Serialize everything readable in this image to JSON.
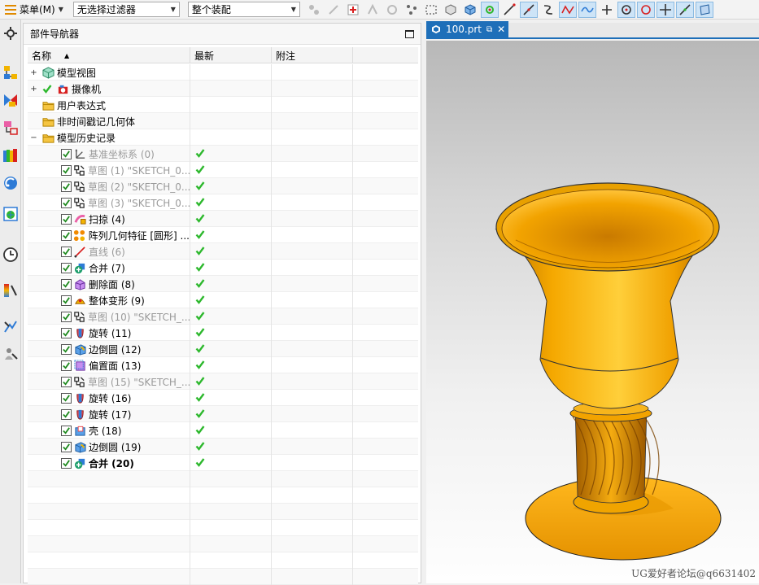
{
  "toolbar": {
    "menu_label": "菜单(M)",
    "filter_value": "无选择过滤器",
    "assembly_value": "整个装配"
  },
  "navigator": {
    "title": "部件导航器",
    "columns": [
      "名称",
      "最新",
      "附注"
    ]
  },
  "tree": {
    "top": [
      {
        "label": "模型视图",
        "icon": "model-views-icon"
      },
      {
        "label": "摄像机",
        "icon": "camera-icon"
      },
      {
        "label": "用户表达式",
        "icon": "folder-icon"
      },
      {
        "label": "非时间戳记几何体",
        "icon": "folder-icon"
      },
      {
        "label": "模型历史记录",
        "icon": "folder-icon"
      }
    ],
    "features": [
      {
        "label": "基准坐标系 (0)",
        "icon": "datum-csys-icon",
        "suppressed": true
      },
      {
        "label": "草图 (1) \"SKETCH_0...",
        "icon": "sketch-icon",
        "suppressed": true
      },
      {
        "label": "草图 (2) \"SKETCH_0...",
        "icon": "sketch-icon",
        "suppressed": true
      },
      {
        "label": "草图 (3) \"SKETCH_0...",
        "icon": "sketch-icon",
        "suppressed": true
      },
      {
        "label": "扫掠 (4)",
        "icon": "sweep-icon",
        "suppressed": false
      },
      {
        "label": "阵列几何特征 [圆形] ...",
        "icon": "pattern-icon",
        "suppressed": false
      },
      {
        "label": "直线 (6)",
        "icon": "line-icon",
        "suppressed": true
      },
      {
        "label": "合并 (7)",
        "icon": "unite-icon",
        "suppressed": false
      },
      {
        "label": "删除面 (8)",
        "icon": "delete-face-icon",
        "suppressed": false
      },
      {
        "label": "整体变形 (9)",
        "icon": "global-shaping-icon",
        "suppressed": false
      },
      {
        "label": "草图 (10) \"SKETCH_...",
        "icon": "sketch-icon",
        "suppressed": true
      },
      {
        "label": "旋转 (11)",
        "icon": "revolve-icon",
        "suppressed": false
      },
      {
        "label": "边倒圆 (12)",
        "icon": "edge-blend-icon",
        "suppressed": false
      },
      {
        "label": "偏置面 (13)",
        "icon": "offset-face-icon",
        "suppressed": false
      },
      {
        "label": "草图 (15) \"SKETCH_...",
        "icon": "sketch-icon",
        "suppressed": true
      },
      {
        "label": "旋转 (16)",
        "icon": "revolve-icon",
        "suppressed": false
      },
      {
        "label": "旋转 (17)",
        "icon": "revolve-icon",
        "suppressed": false
      },
      {
        "label": "壳 (18)",
        "icon": "shell-icon",
        "suppressed": false
      },
      {
        "label": "边倒圆 (19)",
        "icon": "edge-blend-icon",
        "suppressed": false
      },
      {
        "label": "合并 (20)",
        "icon": "unite-icon",
        "suppressed": false,
        "current": true
      }
    ]
  },
  "graphics": {
    "tab_label": "100.prt",
    "watermark": "UG爱好者论坛@q6631402"
  },
  "colors": {
    "accent": "#1e6fb9",
    "model_orange": "#f2a300",
    "check_green": "#2db82d"
  }
}
